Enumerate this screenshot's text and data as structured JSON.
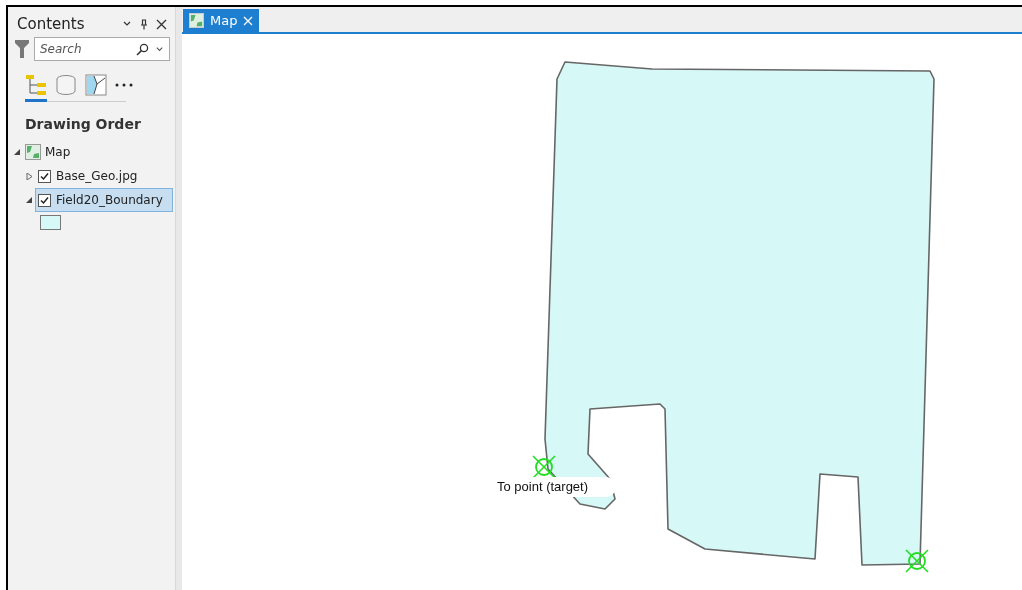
{
  "contents_pane": {
    "title": "Contents",
    "search": {
      "placeholder": "Search"
    },
    "view_tabs": [
      {
        "kind": "drawing-order",
        "selected": true
      },
      {
        "kind": "source",
        "selected": false
      },
      {
        "kind": "selection",
        "selected": false
      },
      {
        "kind": "more",
        "selected": false
      }
    ],
    "heading": "Drawing Order",
    "tree": [
      {
        "label": "Map",
        "kind": "map",
        "expanded": true,
        "children": [
          {
            "label": "Base_Geo.jpg",
            "checked": true,
            "expanded": false,
            "selected": false
          },
          {
            "label": "Field20_Boundary",
            "checked": true,
            "expanded": true,
            "selected": true
          }
        ]
      }
    ]
  },
  "map_view": {
    "tabs": [
      {
        "label": "Map",
        "selected": true
      }
    ],
    "features": [
      {
        "kind": "label",
        "text": "To point (target)"
      }
    ]
  }
}
